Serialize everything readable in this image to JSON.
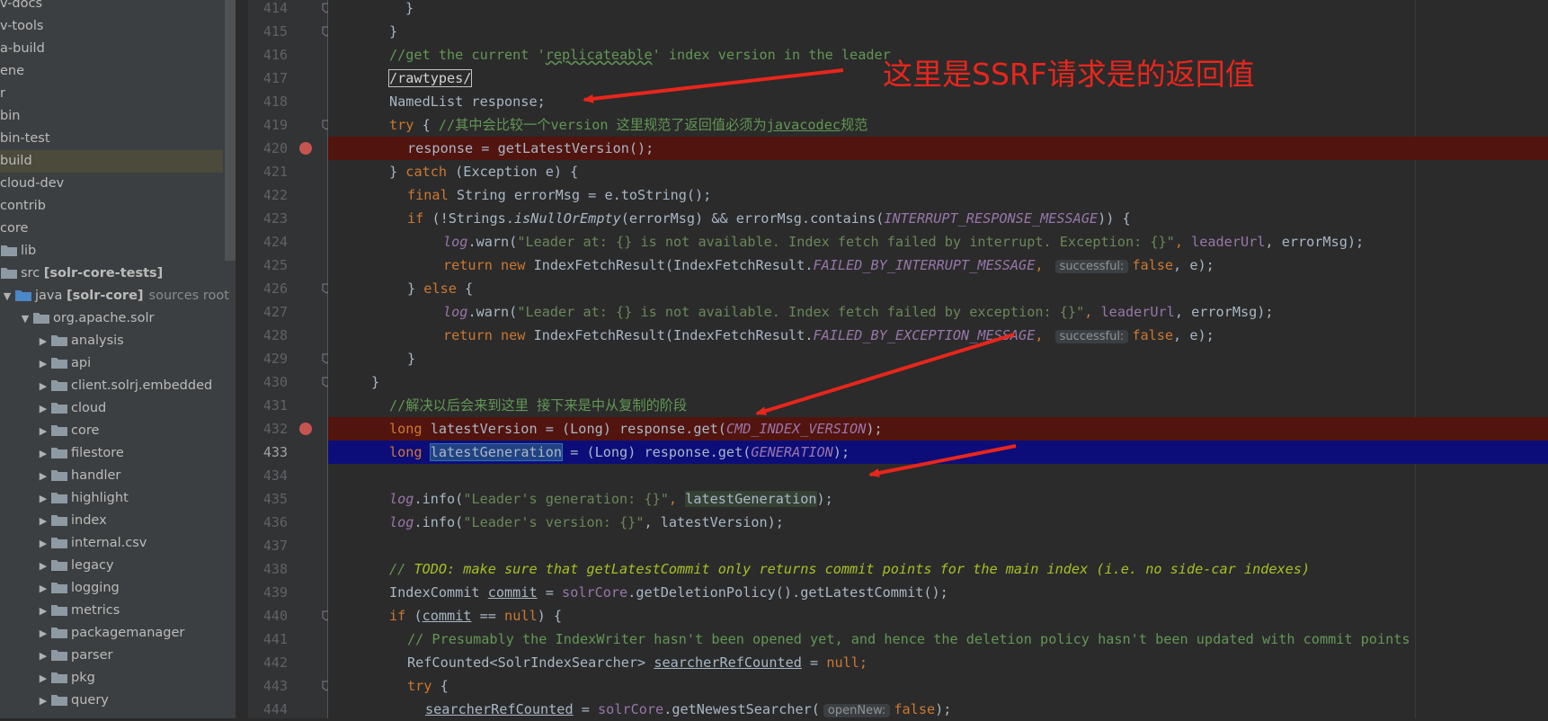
{
  "project_tree": {
    "items": [
      {
        "label": "v-docs"
      },
      {
        "label": "v-tools"
      },
      {
        "label": "a-build"
      },
      {
        "label": "ene"
      },
      {
        "label": "r"
      },
      {
        "label": "bin"
      },
      {
        "label": "bin-test"
      },
      {
        "label": "build",
        "selected": true
      },
      {
        "label": "cloud-dev"
      },
      {
        "label": "contrib"
      },
      {
        "label": "core"
      },
      {
        "label": "lib"
      },
      {
        "label": "src",
        "tag": "[solr-core-tests]"
      },
      {
        "label": "java",
        "tag": "[solr-core]",
        "hint": "sources root"
      },
      {
        "label": "org.apache.solr"
      },
      {
        "label": "analysis"
      },
      {
        "label": "api"
      },
      {
        "label": "client.solrj.embedded"
      },
      {
        "label": "cloud"
      },
      {
        "label": "core"
      },
      {
        "label": "filestore"
      },
      {
        "label": "handler"
      },
      {
        "label": "highlight"
      },
      {
        "label": "index"
      },
      {
        "label": "internal.csv"
      },
      {
        "label": "legacy"
      },
      {
        "label": "logging"
      },
      {
        "label": "metrics"
      },
      {
        "label": "packagemanager"
      },
      {
        "label": "parser"
      },
      {
        "label": "pkg"
      },
      {
        "label": "query"
      }
    ]
  },
  "editor": {
    "line_numbers": [
      "414",
      "415",
      "416",
      "417",
      "418",
      "419",
      "420",
      "421",
      "422",
      "423",
      "424",
      "425",
      "426",
      "427",
      "428",
      "429",
      "430",
      "431",
      "432",
      "433",
      "434",
      "435",
      "436",
      "437",
      "438",
      "439",
      "440",
      "441",
      "442",
      "443",
      "444"
    ],
    "current_line": "433",
    "breakpoint_lines": [
      "420",
      "432"
    ]
  },
  "code": {
    "l414": "}",
    "l415": "}",
    "l416a": "//get the current '",
    "l416b": "replicateable",
    "l416c": "' index version in the leader",
    "l417": "/rawtypes/",
    "l418": "NamedList response;",
    "l419a": "try",
    "l419b": " { ",
    "l419c": "//其中会比较一个version 这里规范了返回值必须为",
    "l419d": "javacodec",
    "l419e": "规范",
    "l420": "response = getLatestVersion();",
    "l421a": "} ",
    "l421b": "catch",
    "l421c": " (Exception e) {",
    "l422a": "final",
    "l422b": " String errorMsg = e.toString();",
    "l423a": "if",
    "l423b": " (!Strings.",
    "l423c": "isNullOrEmpty",
    "l423d": "(errorMsg) && errorMsg.contains(",
    "l423e": "INTERRUPT_RESPONSE_MESSAGE",
    "l423f": ")) {",
    "l424a": "log",
    "l424b": ".warn(",
    "l424c": "\"Leader at: {} is not available. Index fetch failed by interrupt. Exception: {}\"",
    "l424d": ", ",
    "l424e": "leaderUrl",
    "l424f": ", errorMsg);",
    "l425a": "return new",
    "l425b": " IndexFetchResult(IndexFetchResult.",
    "l425c": "FAILED_BY_INTERRUPT_MESSAGE",
    "l425d": ", ",
    "l425e": "successful:",
    "l425f": "false",
    "l425g": ", e);",
    "l426a": "} ",
    "l426b": "else",
    "l426c": " {",
    "l427a": "log",
    "l427b": ".warn(",
    "l427c": "\"Leader at: {} is not available. Index fetch failed by exception: {}\"",
    "l427d": ", ",
    "l427e": "leaderUrl",
    "l427f": ", errorMsg);",
    "l428a": "return new",
    "l428b": " IndexFetchResult(IndexFetchResult.",
    "l428c": "FAILED_BY_EXCEPTION_MESSAGE",
    "l428d": ", ",
    "l428e": "successful:",
    "l428f": "false",
    "l428g": ", e);",
    "l429": "}",
    "l430": "}",
    "l431": "//解决以后会来到这里 接下来是中从复制的阶段",
    "l432a": "long",
    "l432b": " latestVersion = (Long) response.get(",
    "l432c": "CMD_INDEX_VERSION",
    "l432d": ");",
    "l433a": "long",
    "l433b": "latestGeneration",
    "l433c": " = (Long) response.get(",
    "l433d": "GENERATION",
    "l433e": ");",
    "l435a": "log",
    "l435b": ".info(",
    "l435c": "\"Leader's generation: {}\"",
    "l435d": ", ",
    "l435e": "latestGeneration",
    "l435f": ");",
    "l436a": "log",
    "l436b": ".info(",
    "l436c": "\"Leader's version: {}\"",
    "l436d": ", latestVersion);",
    "l438a": "// ",
    "l438b": "TODO: make sure that getLatestCommit only returns commit points for the main index (i.e. no side-car indexes)",
    "l439a": "IndexCommit ",
    "l439b": "commit",
    "l439c": " = ",
    "l439d": "solrCore",
    "l439e": ".getDeletionPolicy().getLatestCommit();",
    "l440a": "if",
    "l440b": " (",
    "l440c": "commit",
    "l440d": " == ",
    "l440e": "null",
    "l440f": ") {",
    "l441": "// Presumably the IndexWriter hasn't been opened yet, and hence the deletion policy hasn't been updated with commit points",
    "l442a": "RefCounted<SolrIndexSearcher> ",
    "l442b": "searcherRefCounted",
    "l442c": " = ",
    "l442d": "null",
    "l442e": ";",
    "l443a": "try",
    "l443b": " {",
    "l444a": "searcherRefCounted",
    "l444b": " = ",
    "l444c": "solrCore",
    "l444d": ".getNewestSearcher(",
    "l444e": "openNew:",
    "l444f": "false",
    "l444g": ");"
  },
  "annotation": {
    "text": "这里是SSRF请求是的返回值",
    "color": "#e8261c"
  },
  "colors": {
    "breakpoint_line_bg": "#52140e",
    "current_line_bg": "#0d0d7a",
    "keyword": "#cc7832",
    "comment": "#629755",
    "string": "#6a8759",
    "constant": "#9876aa"
  },
  "icons": {
    "tree_folder": "folder-icon",
    "tree_expand": "chevron-right-icon",
    "tree_collapse": "chevron-down-icon",
    "breakpoint": "breakpoint-icon",
    "fold": "fold-marker-icon"
  }
}
